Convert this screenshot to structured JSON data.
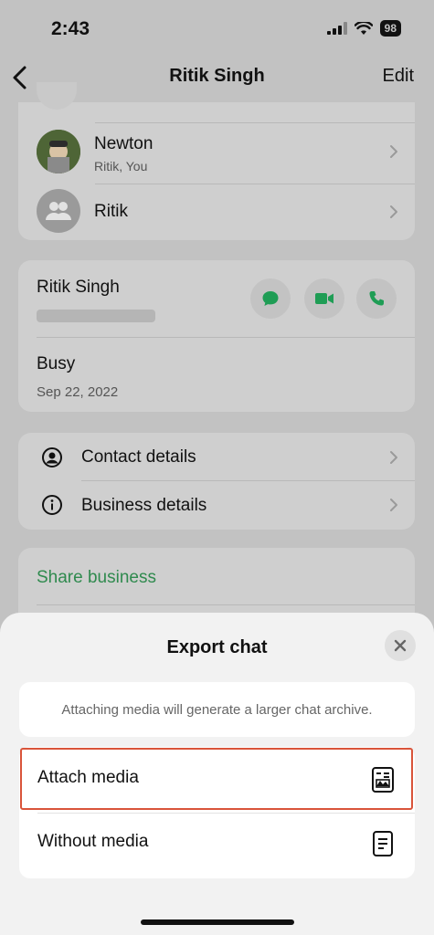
{
  "status": {
    "time": "2:43",
    "battery": "98"
  },
  "nav": {
    "title": "Ritik Singh",
    "edit": "Edit"
  },
  "groups": [
    {
      "name": "Newton",
      "members": "Ritik, You"
    },
    {
      "name": "Ritik",
      "members": ""
    }
  ],
  "contact": {
    "name": "Ritik Singh",
    "about": "Busy",
    "about_date": "Sep 22, 2022"
  },
  "details": {
    "contact_details": "Contact details",
    "business_details": "Business details"
  },
  "share_business": "Share business",
  "sheet": {
    "title": "Export chat",
    "info": "Attaching media will generate a larger chat archive.",
    "options": [
      {
        "label": "Attach media",
        "icon": "media-document-icon"
      },
      {
        "label": "Without media",
        "icon": "text-document-icon"
      }
    ]
  },
  "colors": {
    "accent": "#1f9d55",
    "highlight": "#d9543a"
  }
}
